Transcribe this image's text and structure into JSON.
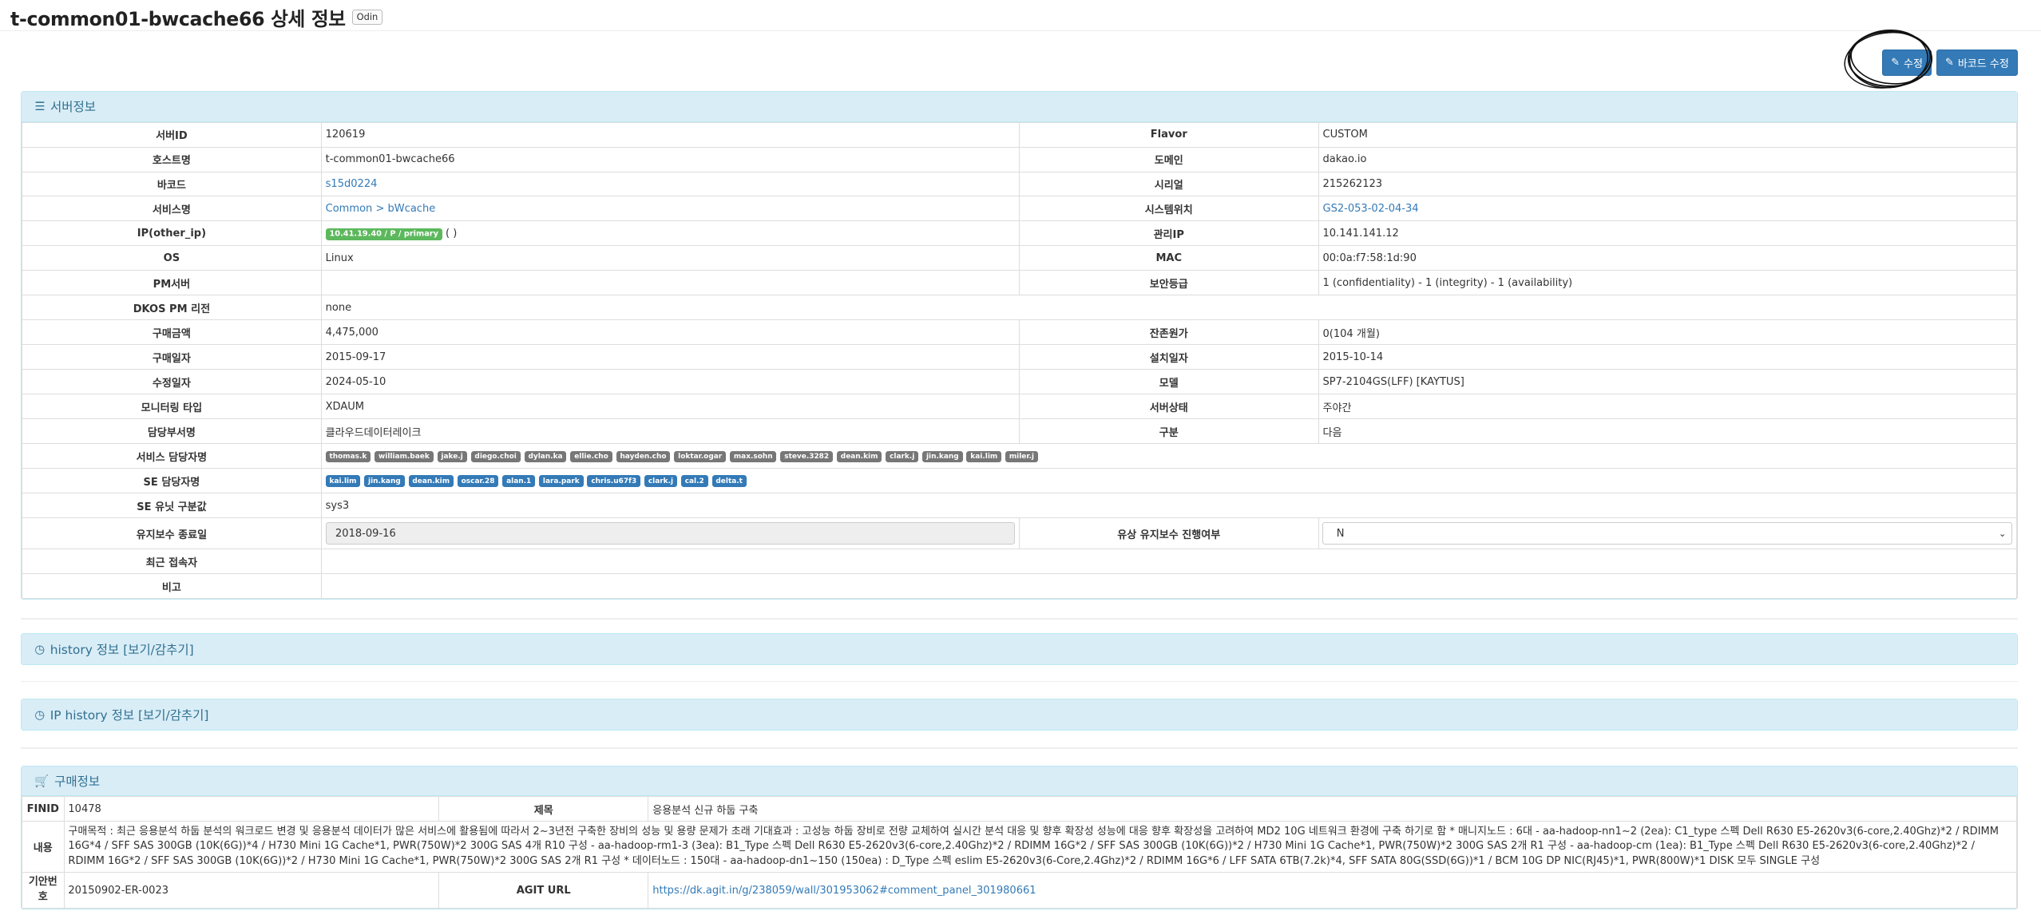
{
  "title": "t-common01-bwcache66 상세 정보",
  "title_tag": "Odin",
  "actions": {
    "edit_label": "수정",
    "barcode_edit_label": "바코드 수정"
  },
  "server_panel": {
    "heading": "서버정보",
    "rows": [
      {
        "l1": "서버ID",
        "v1": "120619",
        "l2": "Flavor",
        "v2": "CUSTOM"
      },
      {
        "l1": "호스트명",
        "v1": "t-common01-bwcache66",
        "l2": "도메인",
        "v2": "dakao.io"
      },
      {
        "l1": "바코드",
        "v1": "s15d0224",
        "l2": "시리얼",
        "v2": "215262123"
      },
      {
        "l1": "서비스명",
        "v1": "Common > bWcache",
        "l2": "시스템위치",
        "v2": "GS2-053-02-04-34"
      },
      {
        "l1": "IP(other_ip)",
        "v1_badge": "10.41.19.40 / P / primary",
        "v1_suffix": "( )",
        "l2": "관리IP",
        "v2": "10.141.141.12"
      },
      {
        "l1": "OS",
        "v1": "Linux",
        "l2": "MAC",
        "v2": "00:0a:f7:58:1d:90"
      },
      {
        "l1": "PM서버",
        "v1": "",
        "l2": "보안등급",
        "v2": "1 (confidentiality) - 1 (integrity) - 1 (availability)"
      },
      {
        "l1": "DKOS PM 리전",
        "v1": "none"
      },
      {
        "l1": "구매금액",
        "v1": "4,475,000",
        "l2": "잔존원가",
        "v2": "0(104 개월)"
      },
      {
        "l1": "구매일자",
        "v1": "2015-09-17",
        "l2": "설치일자",
        "v2": "2015-10-14"
      },
      {
        "l1": "수정일자",
        "v1": "2024-05-10",
        "l2": "모델",
        "v2": "SP7-2104GS(LFF) [KAYTUS]"
      },
      {
        "l1": "모니터링 타입",
        "v1": "XDAUM",
        "l2": "서버상태",
        "v2": "주야간"
      },
      {
        "l1": "담당부서명",
        "v1": "클라우드데이터레이크",
        "l2": "구분",
        "v2": "다음"
      }
    ],
    "service_managers_label": "서비스 담당자명",
    "service_managers": [
      "thomas.k",
      "william.baek",
      "jake.j",
      "diego.choi",
      "dylan.ka",
      "ellie.cho",
      "hayden.cho",
      "loktar.ogar",
      "max.sohn",
      "steve.3282",
      "dean.kim",
      "clark.j",
      "jin.kang",
      "kai.lim",
      "miler.j"
    ],
    "se_managers_label": "SE 담당자명",
    "se_managers": [
      "kai.lim",
      "jin.kang",
      "dean.kim",
      "oscar.28",
      "alan.1",
      "lara.park",
      "chris.u67f3",
      "clark.j",
      "cal.2",
      "delta.t"
    ],
    "se_unit_label": "SE 유닛 구분값",
    "se_unit_value": "sys3",
    "maintenance_end_label": "유지보수 종료일",
    "maintenance_end_value": "2018-09-16",
    "paid_maintenance_label": "유상 유지보수 진행여부",
    "paid_maintenance_value": "N",
    "recent_accessor_label": "최근 접속자",
    "recent_accessor_value": "",
    "remarks_label": "비고",
    "remarks_value": ""
  },
  "history_panel": {
    "heading": "history 정보 [보기/감추기]"
  },
  "ip_history_panel": {
    "heading": "IP history 정보 [보기/감추기]"
  },
  "purchase_panel": {
    "heading": "구매정보",
    "finid_label": "FINID",
    "finid_value": "10478",
    "subject_label": "제목",
    "subject_value": "응용분석 신규 하둡 구축",
    "content_label": "내용",
    "content_value": "구매목적 : 최근 응용분석 하둡 분석의 워크로드 변경 및 응용분석 데이터가 많은 서비스에 활용됨에 따라서 2~3년전 구축한 장비의 성능 및 용량 문제가 초래 기대효과 : 고성능 하둡 장비로 전량 교체하여 실시간 분석 대응 및 향후 확장성 성능에 대응 향후 확장성을 고려하여 MD2 10G 네트워크 환경에 구축 하기로 함 * 매니지노드 : 6대 - aa-hadoop-nn1~2 (2ea): C1_type 스펙 Dell R630 E5-2620v3(6-core,2.40Ghz)*2 / RDIMM 16G*4 / SFF SAS 300GB (10K(6G))*4 / H730 Mini 1G Cache*1, PWR(750W)*2 300G SAS 4개 R10 구성 - aa-hadoop-rm1-3 (3ea): B1_Type 스펙 Dell R630 E5-2620v3(6-core,2.40Ghz)*2 / RDIMM 16G*2 / SFF SAS 300GB (10K(6G))*2 / H730 Mini 1G Cache*1, PWR(750W)*2 300G SAS 2개 R1 구성 - aa-hadoop-cm (1ea): B1_Type 스펙 Dell R630 E5-2620v3(6-core,2.40Ghz)*2 / RDIMM 16G*2 / SFF SAS 300GB (10K(6G))*2 / H730 Mini 1G Cache*1, PWR(750W)*2 300G SAS 2개 R1 구성 * 데이터노드 : 150대 - aa-hadoop-dn1~150 (150ea) : D_Type 스펙 eslim E5-2620v3(6-Core,2.4Ghz)*2 / RDIMM 16G*6 / LFF SATA 6TB(7.2k)*4, SFF SATA 80G(SSD(6G))*1 / BCM 10G DP NIC(RJ45)*1, PWR(800W)*1 DISK 모두 SINGLE 구성",
    "draft_label": "기안번호",
    "draft_value": "20150902-ER-0023",
    "agit_label": "AGIT URL",
    "agit_value": "https://dk.agit.in/g/238059/wall/301953062#comment_panel_301980661"
  },
  "colors": {
    "primary": "#337ab7",
    "panel_heading_bg": "#d9edf7",
    "panel_heading_text": "#31708f",
    "ip_badge": "#5cb85c",
    "manager_tag": "#777777"
  },
  "icons": [
    "edit-icon",
    "list-icon",
    "clock-icon",
    "cart-icon",
    "chevron-down-icon"
  ]
}
